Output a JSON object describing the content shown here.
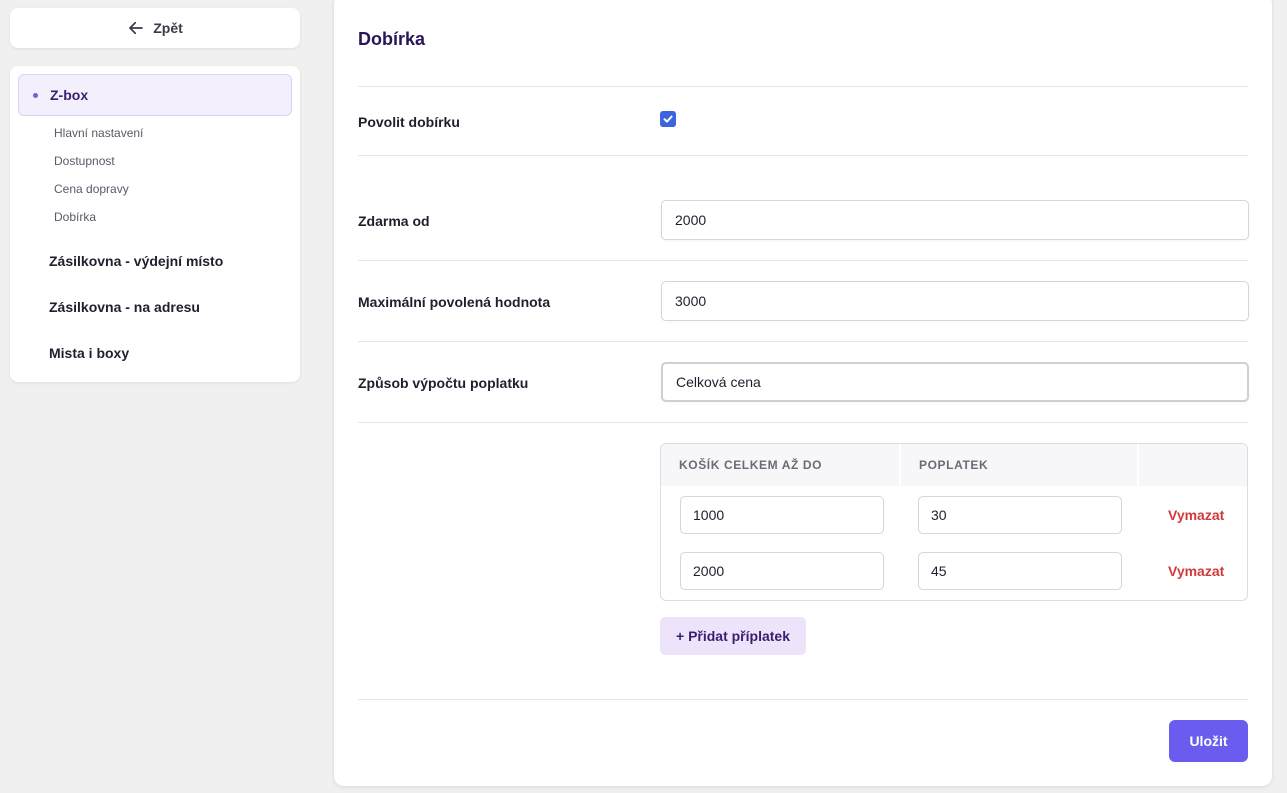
{
  "back": {
    "label": "Zpět",
    "icon": "arrow-left-icon"
  },
  "sidebar": {
    "active_item": "Z-box",
    "sub_items": [
      "Hlavní nastavení",
      "Dostupnost",
      "Cena dopravy",
      "Dobírka"
    ],
    "items": [
      "Zásilkovna - výdejní místo",
      "Zásilkovna - na adresu",
      "Mista i boxy"
    ]
  },
  "form": {
    "title": "Dobírka",
    "enable_cod": {
      "label": "Povolit dobírku",
      "checked": true
    },
    "free_from": {
      "label": "Zdarma od",
      "value": "2000"
    },
    "max_value": {
      "label": "Maximální povolená hodnota",
      "value": "3000"
    },
    "fee_method": {
      "label": "Způsob výpočtu poplatku",
      "value": "Celková cena"
    }
  },
  "fee_table": {
    "headers": [
      "KOŠÍK CELKEM AŽ DO",
      "POPLATEK",
      ""
    ],
    "rows": [
      {
        "cart_total": "1000",
        "fee": "30",
        "action": "Vymazat"
      },
      {
        "cart_total": "2000",
        "fee": "45",
        "action": "Vymazat"
      }
    ],
    "add_label": "+ Přidat příplatek"
  },
  "save_label": "Uložit",
  "colors": {
    "accent": "#6b5cf0",
    "title": "#2a1559",
    "danger": "#d13a3a",
    "checkbox": "#3c63e0"
  }
}
